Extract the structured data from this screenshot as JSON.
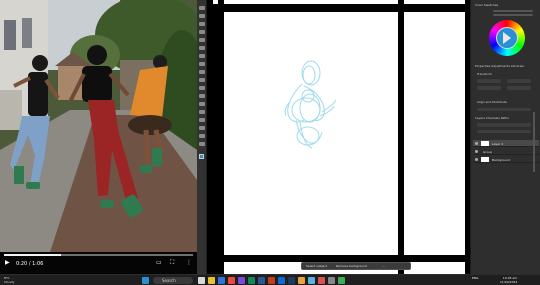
{
  "video": {
    "current_time": "0:20 / 1:06",
    "progress": 0.3,
    "play_icon": "play-icon",
    "volume_icon": "volume-icon",
    "captions_icon": "captions-icon",
    "fullscreen_icon": "fullscreen-icon",
    "more_icon": "more-options-icon"
  },
  "photoshop": {
    "panel_tabs_top": "Color  Swatches",
    "properties_tabs": "Properties  Adjustments  Libraries",
    "transform_label": "Transform",
    "align_label": "Align and Distribute",
    "layers_tabs": "Layers  Channels  Paths",
    "layers": [
      {
        "name": "Layer 1"
      },
      {
        "name": "Group"
      },
      {
        "name": "Background"
      }
    ],
    "bottom_buttons": [
      "Select subject",
      "Remove background"
    ]
  },
  "taskbar": {
    "search_placeholder": "Search",
    "weather_temp": "8°C",
    "weather_desc": "Cloudy",
    "time": "10:05 am",
    "date": "11/04/2024",
    "lang": "ENG"
  },
  "colors": {
    "accent": "#2b8fd6",
    "sketch": "#9fdcee",
    "shirt_black": "#141414",
    "red_pants": "#9b2424",
    "orange_dress": "#e0892d"
  }
}
